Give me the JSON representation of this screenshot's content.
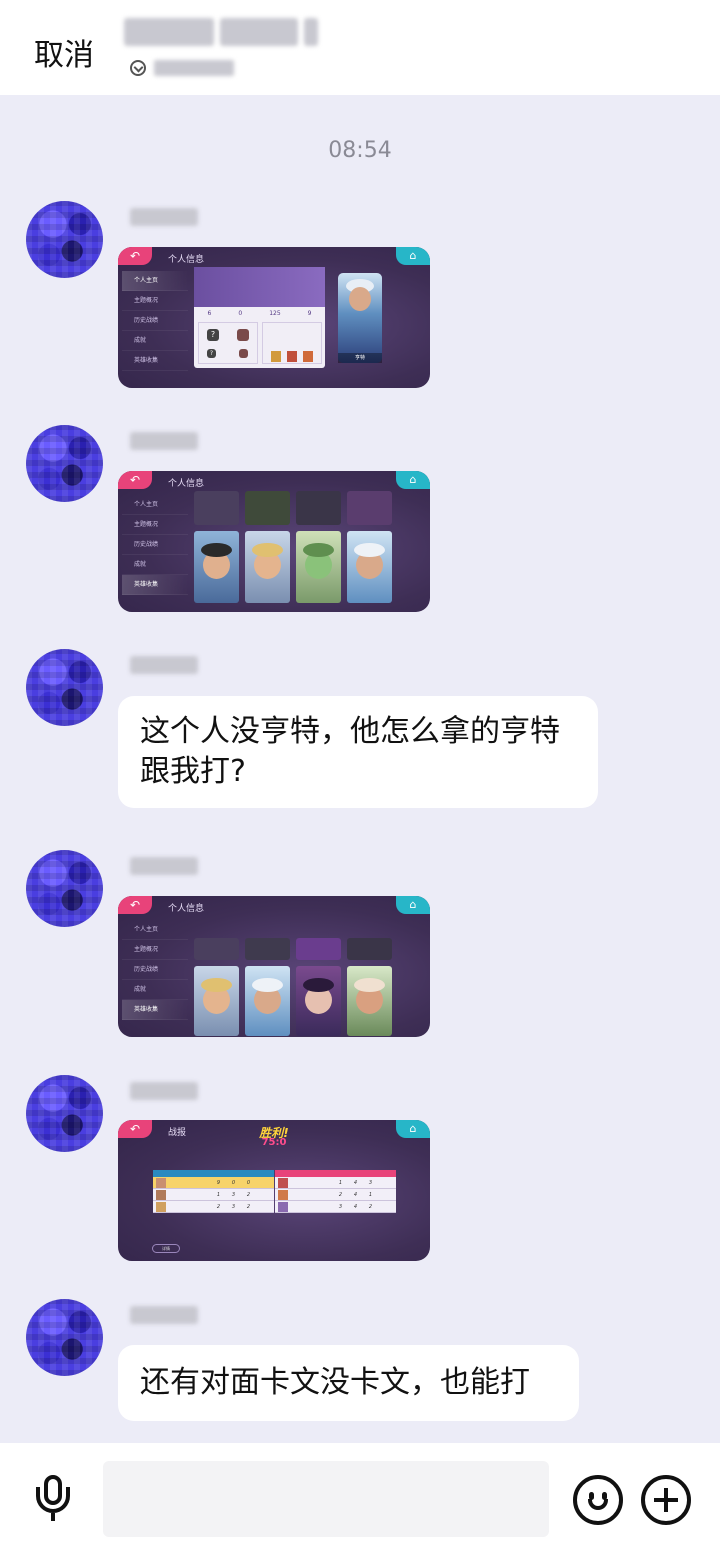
{
  "header": {
    "cancel_label": "取消"
  },
  "chat": {
    "timestamp": "08:54",
    "shot1": {
      "back": "↶",
      "home": "⌂",
      "title": "个人信息",
      "menu": [
        "个人主页",
        "主题概况",
        "历史战绩",
        "成就",
        "英雄收集"
      ],
      "stats": [
        "6",
        "0",
        "125",
        "9"
      ],
      "hero_name": "亨特"
    },
    "shot2": {
      "back": "↶",
      "home": "⌂",
      "title": "个人信息",
      "menu": [
        "个人主页",
        "主题概况",
        "历史战绩",
        "成就",
        "英雄收集"
      ]
    },
    "message1": "这个人没亨特，他怎么拿的亨特跟我打?",
    "shot3": {
      "back": "↶",
      "home": "⌂",
      "title": "个人信息",
      "menu": [
        "个人主页",
        "主题概况",
        "历史战绩",
        "成就",
        "英雄收集"
      ]
    },
    "shot4": {
      "back": "↶",
      "home": "⌂",
      "title": "战报",
      "result": "胜利!",
      "score": "75:0",
      "detail": "详情",
      "left_rows": [
        {
          "kills": "9",
          "deaths": "0",
          "assists": "0"
        },
        {
          "kills": "1",
          "deaths": "3",
          "assists": "2"
        },
        {
          "kills": "2",
          "deaths": "3",
          "assists": "2"
        }
      ],
      "right_rows": [
        {
          "kills": "1",
          "deaths": "4",
          "assists": "3"
        },
        {
          "kills": "2",
          "deaths": "4",
          "assists": "1"
        },
        {
          "kills": "3",
          "deaths": "4",
          "assists": "2"
        }
      ]
    },
    "message2": "还有对面卡文没卡文，也能打"
  },
  "input_bar": {
    "mic_icon": "mic-icon",
    "emoji_icon": "emoji-icon",
    "plus_icon": "plus-icon"
  }
}
